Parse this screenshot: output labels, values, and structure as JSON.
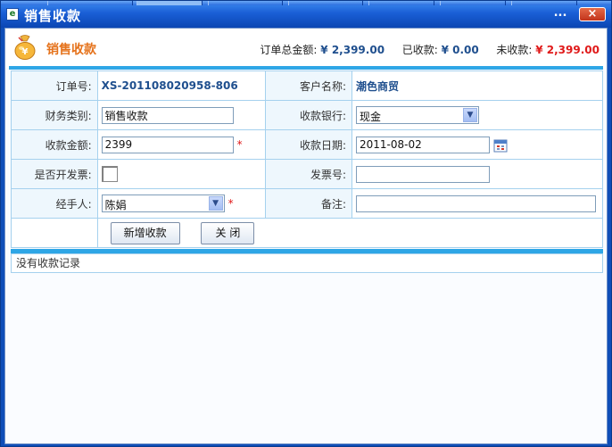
{
  "window": {
    "title": "销售收款",
    "more_label": "...",
    "close_label": "×"
  },
  "header": {
    "title": "销售收款",
    "order_total_label": "订单总金额:",
    "order_total_value": "¥ 2,399.00",
    "received_label": "已收款:",
    "received_value": "¥ 0.00",
    "unreceived_label": "未收款:",
    "unreceived_value": "¥ 2,399.00"
  },
  "form": {
    "order_no_label": "订单号:",
    "order_no_value": "XS-201108020958-806",
    "customer_label": "客户名称:",
    "customer_value": "潮色商贸",
    "finance_type_label": "财务类别:",
    "finance_type_value": "销售收款",
    "bank_label": "收款银行:",
    "bank_value": "现金",
    "amount_label": "收款金额:",
    "amount_value": "2399",
    "date_label": "收款日期:",
    "date_value": "2011-08-02",
    "invoice_flag_label": "是否开发票:",
    "invoice_no_label": "发票号:",
    "invoice_no_value": "",
    "handler_label": "经手人:",
    "handler_value": "陈娟",
    "remark_label": "备注:",
    "remark_value": "",
    "required_mark": "*"
  },
  "buttons": {
    "add_label": "新增收款",
    "close_label": "关 闭"
  },
  "records": {
    "empty_text": "没有收款记录"
  },
  "colors": {
    "accent_orange": "#e5721b",
    "accent_blue_bar": "#2ea6e6",
    "value_red": "#e01a1a",
    "value_blue": "#1f4f8e"
  }
}
